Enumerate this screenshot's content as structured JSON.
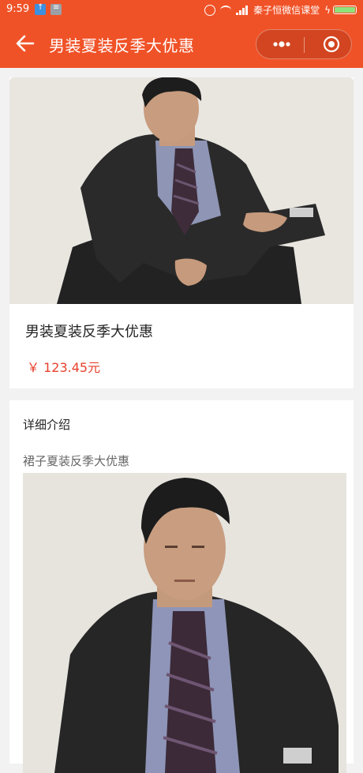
{
  "status_bar": {
    "time": "9:59",
    "carrier": "秦子恒微信课堂"
  },
  "title_bar": {
    "title": "男装夏装反季大优惠"
  },
  "product": {
    "name": "男装夏装反季大优惠",
    "price": "￥ 123.45元",
    "price_color": "#e8412c"
  },
  "detail": {
    "heading": "详细介绍",
    "subtitle": "裙子夏装反季大优惠"
  },
  "colors": {
    "brand": "#f05227",
    "background": "#f2f2f2"
  },
  "icons": [
    "back-arrow-icon",
    "more-dots-icon",
    "close-miniprogram-icon",
    "alarm-icon",
    "wifi-icon",
    "signal-icon",
    "battery-icon"
  ]
}
